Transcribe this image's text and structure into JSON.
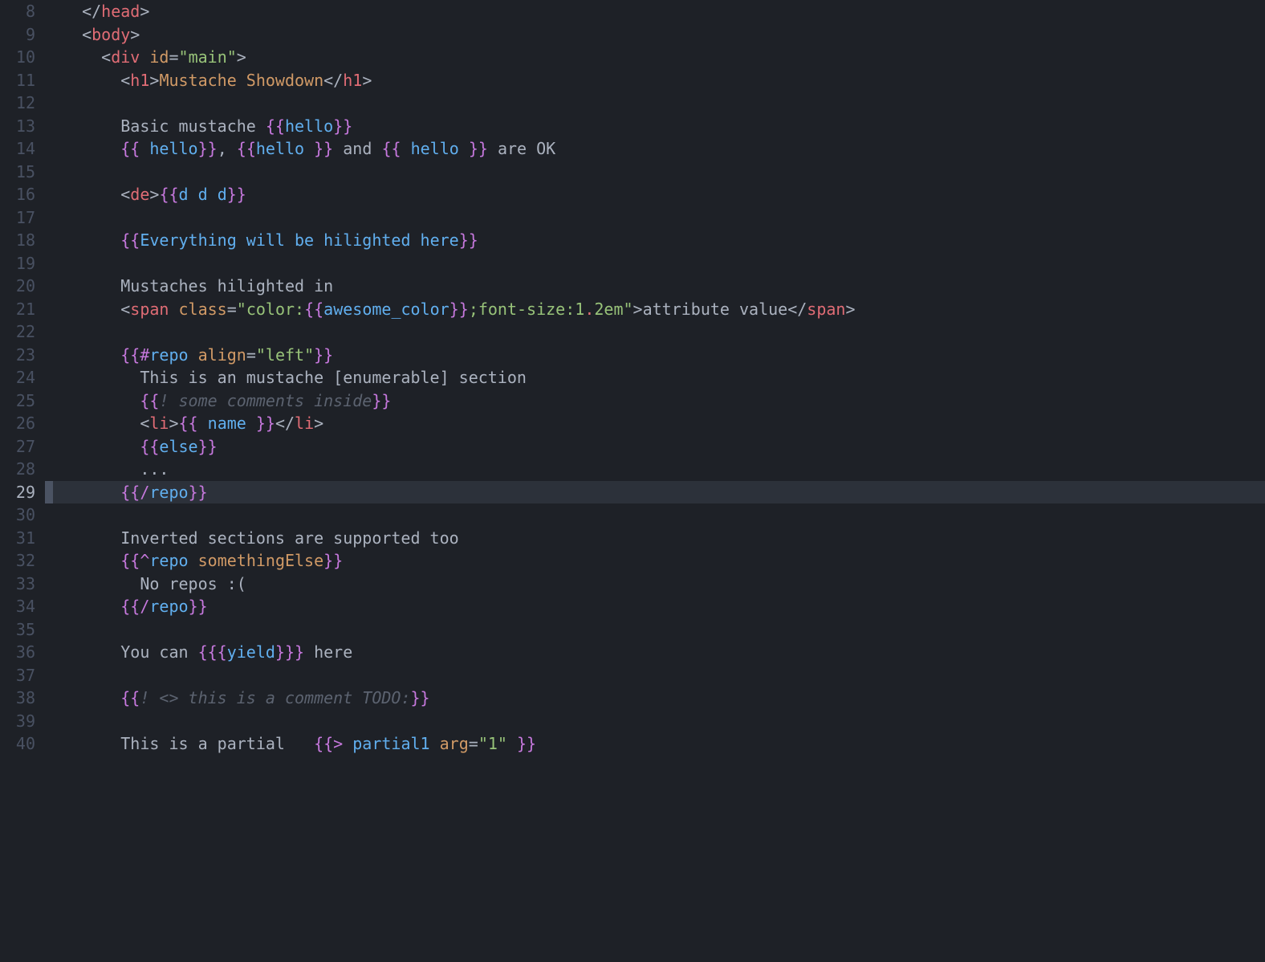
{
  "startLine": 8,
  "currentLine": 29,
  "lines": [
    {
      "n": 8,
      "tokens": [
        {
          "c": "p",
          "t": "  </"
        },
        {
          "c": "t",
          "t": "head"
        },
        {
          "c": "p",
          "t": ">"
        }
      ]
    },
    {
      "n": 9,
      "tokens": [
        {
          "c": "p",
          "t": "  <"
        },
        {
          "c": "t",
          "t": "body"
        },
        {
          "c": "p",
          "t": ">"
        }
      ]
    },
    {
      "n": 10,
      "tokens": [
        {
          "c": "p",
          "t": "    <"
        },
        {
          "c": "t",
          "t": "div"
        },
        {
          "c": "p",
          "t": " "
        },
        {
          "c": "a",
          "t": "id"
        },
        {
          "c": "p",
          "t": "="
        },
        {
          "c": "s",
          "t": "\"main\""
        },
        {
          "c": "p",
          "t": ">"
        }
      ]
    },
    {
      "n": 11,
      "tokens": [
        {
          "c": "p",
          "t": "      <"
        },
        {
          "c": "t",
          "t": "h1"
        },
        {
          "c": "p",
          "t": ">"
        },
        {
          "c": "a",
          "t": "Mustache Showdown"
        },
        {
          "c": "p",
          "t": "</"
        },
        {
          "c": "t",
          "t": "h1"
        },
        {
          "c": "p",
          "t": ">"
        }
      ]
    },
    {
      "n": 12,
      "tokens": []
    },
    {
      "n": 13,
      "tokens": [
        {
          "c": "txt",
          "t": "      Basic mustache "
        },
        {
          "c": "m",
          "t": "{{"
        },
        {
          "c": "v",
          "t": "hello"
        },
        {
          "c": "m",
          "t": "}}"
        }
      ]
    },
    {
      "n": 14,
      "tokens": [
        {
          "c": "txt",
          "t": "      "
        },
        {
          "c": "m",
          "t": "{{"
        },
        {
          "c": "v",
          "t": " hello"
        },
        {
          "c": "m",
          "t": "}}"
        },
        {
          "c": "txt",
          "t": ", "
        },
        {
          "c": "m",
          "t": "{{"
        },
        {
          "c": "v",
          "t": "hello "
        },
        {
          "c": "m",
          "t": "}}"
        },
        {
          "c": "txt",
          "t": " and "
        },
        {
          "c": "m",
          "t": "{{"
        },
        {
          "c": "v",
          "t": " hello "
        },
        {
          "c": "m",
          "t": "}}"
        },
        {
          "c": "txt",
          "t": " are OK"
        }
      ]
    },
    {
      "n": 15,
      "tokens": []
    },
    {
      "n": 16,
      "tokens": [
        {
          "c": "p",
          "t": "      <"
        },
        {
          "c": "t",
          "t": "de"
        },
        {
          "c": "p",
          "t": ">"
        },
        {
          "c": "m",
          "t": "{{"
        },
        {
          "c": "v",
          "t": "d d d"
        },
        {
          "c": "m",
          "t": "}}"
        }
      ]
    },
    {
      "n": 17,
      "tokens": []
    },
    {
      "n": 18,
      "tokens": [
        {
          "c": "txt",
          "t": "      "
        },
        {
          "c": "m",
          "t": "{{"
        },
        {
          "c": "v",
          "t": "Everything will be hilighted here"
        },
        {
          "c": "m",
          "t": "}}"
        }
      ]
    },
    {
      "n": 19,
      "tokens": []
    },
    {
      "n": 20,
      "tokens": [
        {
          "c": "txt",
          "t": "      Mustaches hilighted in"
        }
      ]
    },
    {
      "n": 21,
      "tokens": [
        {
          "c": "p",
          "t": "      <"
        },
        {
          "c": "t",
          "t": "span"
        },
        {
          "c": "p",
          "t": " "
        },
        {
          "c": "a",
          "t": "class"
        },
        {
          "c": "p",
          "t": "="
        },
        {
          "c": "s",
          "t": "\"color:"
        },
        {
          "c": "m",
          "t": "{{"
        },
        {
          "c": "v",
          "t": "awesome_color"
        },
        {
          "c": "m",
          "t": "}}"
        },
        {
          "c": "s",
          "t": ";font-size:1"
        },
        {
          "c": "t",
          "t": "."
        },
        {
          "c": "s",
          "t": "2em\""
        },
        {
          "c": "p",
          "t": ">"
        },
        {
          "c": "txt",
          "t": "attribute value"
        },
        {
          "c": "p",
          "t": "</"
        },
        {
          "c": "t",
          "t": "span"
        },
        {
          "c": "p",
          "t": ">"
        }
      ]
    },
    {
      "n": 22,
      "tokens": []
    },
    {
      "n": 23,
      "tokens": [
        {
          "c": "txt",
          "t": "      "
        },
        {
          "c": "m",
          "t": "{{"
        },
        {
          "c": "mk",
          "t": "#"
        },
        {
          "c": "v",
          "t": "repo"
        },
        {
          "c": "txt",
          "t": " "
        },
        {
          "c": "a",
          "t": "align"
        },
        {
          "c": "p",
          "t": "="
        },
        {
          "c": "s",
          "t": "\"left\""
        },
        {
          "c": "m",
          "t": "}}"
        }
      ]
    },
    {
      "n": 24,
      "tokens": [
        {
          "c": "txt",
          "t": "        This is an mustache [enumerable] section"
        }
      ]
    },
    {
      "n": 25,
      "tokens": [
        {
          "c": "txt",
          "t": "        "
        },
        {
          "c": "m",
          "t": "{{"
        },
        {
          "c": "c",
          "t": "! some comments inside"
        },
        {
          "c": "m",
          "t": "}}"
        }
      ]
    },
    {
      "n": 26,
      "tokens": [
        {
          "c": "p",
          "t": "        <"
        },
        {
          "c": "t",
          "t": "li"
        },
        {
          "c": "p",
          "t": ">"
        },
        {
          "c": "m",
          "t": "{{"
        },
        {
          "c": "v",
          "t": " name "
        },
        {
          "c": "m",
          "t": "}}"
        },
        {
          "c": "p",
          "t": "</"
        },
        {
          "c": "t",
          "t": "li"
        },
        {
          "c": "p",
          "t": ">"
        }
      ]
    },
    {
      "n": 27,
      "tokens": [
        {
          "c": "txt",
          "t": "        "
        },
        {
          "c": "m",
          "t": "{{"
        },
        {
          "c": "v",
          "t": "else"
        },
        {
          "c": "m",
          "t": "}}"
        }
      ]
    },
    {
      "n": 28,
      "tokens": [
        {
          "c": "txt",
          "t": "        ..."
        }
      ]
    },
    {
      "n": 29,
      "tokens": [
        {
          "c": "txt",
          "t": "      "
        },
        {
          "c": "m",
          "t": "{{"
        },
        {
          "c": "mk",
          "t": "/"
        },
        {
          "c": "v",
          "t": "repo"
        },
        {
          "c": "m",
          "t": "}}"
        }
      ]
    },
    {
      "n": 30,
      "tokens": []
    },
    {
      "n": 31,
      "tokens": [
        {
          "c": "txt",
          "t": "      Inverted sections are supported too"
        }
      ]
    },
    {
      "n": 32,
      "tokens": [
        {
          "c": "txt",
          "t": "      "
        },
        {
          "c": "m",
          "t": "{{"
        },
        {
          "c": "mk",
          "t": "^"
        },
        {
          "c": "v",
          "t": "repo"
        },
        {
          "c": "txt",
          "t": " "
        },
        {
          "c": "a",
          "t": "somethingElse"
        },
        {
          "c": "m",
          "t": "}}"
        }
      ]
    },
    {
      "n": 33,
      "tokens": [
        {
          "c": "txt",
          "t": "        No repos :("
        }
      ]
    },
    {
      "n": 34,
      "tokens": [
        {
          "c": "txt",
          "t": "      "
        },
        {
          "c": "m",
          "t": "{{"
        },
        {
          "c": "mk",
          "t": "/"
        },
        {
          "c": "v",
          "t": "repo"
        },
        {
          "c": "m",
          "t": "}}"
        }
      ]
    },
    {
      "n": 35,
      "tokens": []
    },
    {
      "n": 36,
      "tokens": [
        {
          "c": "txt",
          "t": "      You can "
        },
        {
          "c": "m",
          "t": "{{{"
        },
        {
          "c": "v",
          "t": "yield"
        },
        {
          "c": "m",
          "t": "}}}"
        },
        {
          "c": "txt",
          "t": " here"
        }
      ]
    },
    {
      "n": 37,
      "tokens": []
    },
    {
      "n": 38,
      "tokens": [
        {
          "c": "txt",
          "t": "      "
        },
        {
          "c": "m",
          "t": "{{"
        },
        {
          "c": "c",
          "t": "! <> this is a comment TODO:"
        },
        {
          "c": "m",
          "t": "}}"
        }
      ]
    },
    {
      "n": 39,
      "tokens": []
    },
    {
      "n": 40,
      "tokens": [
        {
          "c": "txt",
          "t": "      This is a partial   "
        },
        {
          "c": "m",
          "t": "{{"
        },
        {
          "c": "mk",
          "t": ">"
        },
        {
          "c": "v",
          "t": " partial1"
        },
        {
          "c": "txt",
          "t": " "
        },
        {
          "c": "a",
          "t": "arg"
        },
        {
          "c": "p",
          "t": "="
        },
        {
          "c": "s",
          "t": "\"1\""
        },
        {
          "c": "txt",
          "t": " "
        },
        {
          "c": "m",
          "t": "}}"
        }
      ]
    }
  ]
}
